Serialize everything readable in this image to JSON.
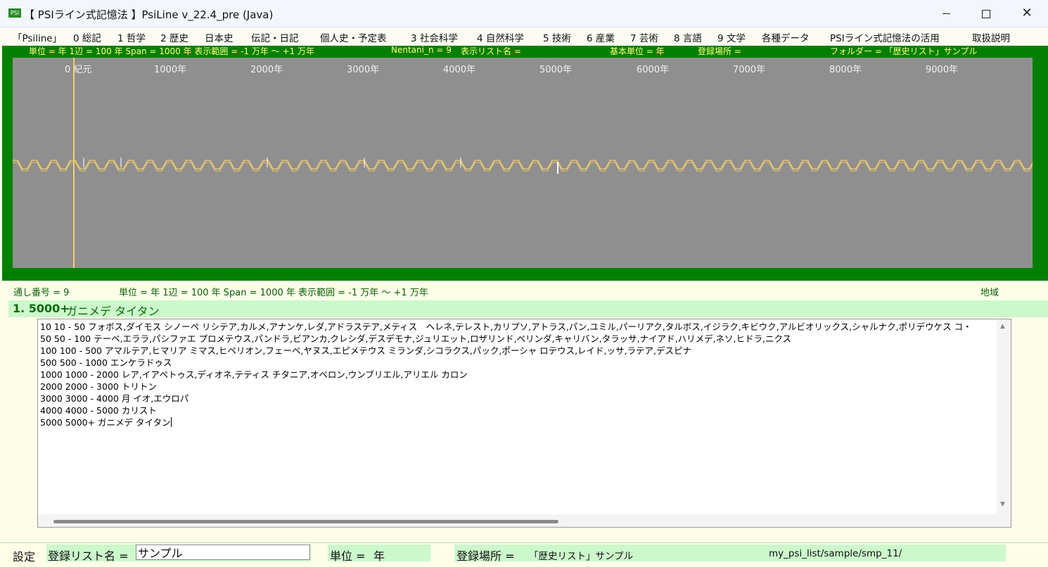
{
  "window": {
    "icon_text": "PSI",
    "title": "【 PSIライン式記憶法 】PsiLine v_22.4_pre (Java)",
    "minimize_label": "",
    "maximize_label": "",
    "close_label": "✕"
  },
  "menu": [
    "「Psiline」",
    "0 総記",
    "1 哲学",
    "2 歴史",
    "日本史",
    "伝記・日記",
    "個人史・予定表",
    "3 社会科学",
    "4 自然科学",
    "5 技術",
    "6 産業",
    "7 芸術",
    "8 言語",
    "9 文学",
    "各種データ",
    "PSIライン式記憶法の活用",
    "取扱説明"
  ],
  "timeline": {
    "info": {
      "unit": "単位 = 年 1辺 = 100 年 Span = 1000 年 表示範囲 = -1 万年 〜 +1 万年",
      "nentani": "Nentani_n = 9",
      "list_name": "表示リスト名 =",
      "base_unit": "基本単位 = 年",
      "location": "登録場所 =",
      "folder": "フォルダー = 「歴史リスト」サンプル"
    },
    "axis_labels": [
      "0 紀元",
      "1000年",
      "2000年",
      "3000年",
      "4000年",
      "5000年",
      "6000年",
      "7000年",
      "8000年",
      "9000年"
    ],
    "line_color": "#f5cf6c",
    "background_color": "#8f8f8f",
    "frame_color": "#038003"
  },
  "status": {
    "serial": "通し番号 = 9",
    "unit_line": "単位 = 年 1辺 = 100 年 Span = 1000 年 表示範囲 = -1 万年 〜 +1 万年",
    "region": "地域"
  },
  "header": {
    "number": "1. 5000+",
    "title": "ガニメデ タイタン"
  },
  "editor": {
    "lines": [
      "10  10 - 50 フォボス,ダイモス シノーペ リシテア,カルメ,アナンケ,レダ,アドラステア,メティス　ヘレネ,テレスト,カリプソ,アトラス,パン,ユミル,パーリアク,タルボス,イジラク,キビウク,アルビオリックス,シャルナク,ポリデウケス コ・",
      "50  50 - 100 テーベ,エララ,パシファエ プロメテウス,パンドラ,ビアンカ,クレシダ,デスデモナ,ジュリエット,ロザリンド,ベリンダ,キャリバン,タラッサ,ナイアド,ハリメデ,ネソ,ヒドラ,ニクス",
      "100  100 - 500 アマルテア,ヒマリア ミマス,ヒペリオン,フェーベ,ヤヌス,エピメテウス ミランダ,シコラクス,パック,ポーシャ ロテウス,レイド,ッサ,ラテア,デスピナ",
      "500  500 - 1000 エンケラドゥス",
      "1000  1000 - 2000 レア,イアペトゥス,ディオネ,テティス チタニア,オベロン,ウンブリエル,アリエル カロン",
      "2000  2000 - 3000 トリトン",
      "3000  3000 - 4000 月 イオ,エウロパ",
      "4000  4000 - 5000 カリスト",
      "5000  5000+ ガニメデ タイタン"
    ]
  },
  "bottom": {
    "settings": "設定",
    "list_name_label": "登録リスト名 =",
    "list_name_value": "サンプル",
    "unit_label": "単位 =",
    "unit_value": "年",
    "location_label": "登録場所 =",
    "location_value": "「歴史リスト」サンプル",
    "path_value": "my_psi_list/sample/smp_11/"
  }
}
